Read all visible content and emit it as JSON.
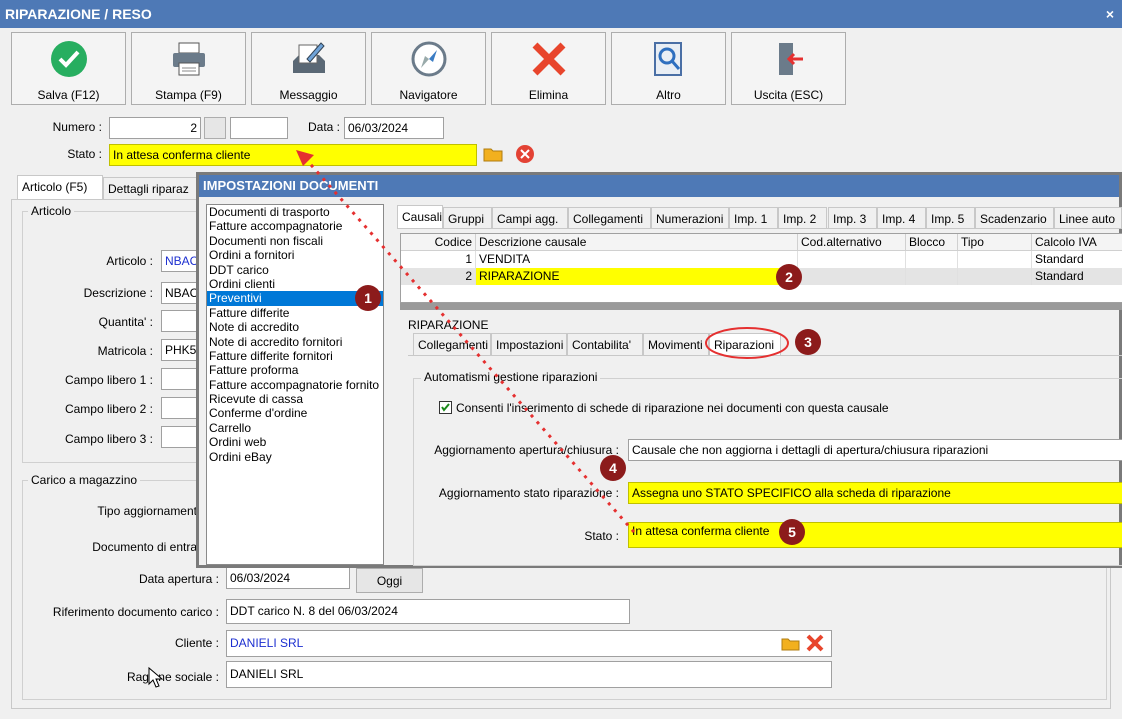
{
  "window": {
    "title": "RIPARAZIONE / RESO",
    "close": "×"
  },
  "toolbar": [
    {
      "label": "Salva (F12)",
      "icon": "check-icon"
    },
    {
      "label": "Stampa (F9)",
      "icon": "printer-icon"
    },
    {
      "label": "Messaggio",
      "icon": "message-icon"
    },
    {
      "label": "Navigatore",
      "icon": "compass-icon"
    },
    {
      "label": "Elimina",
      "icon": "delete-x-icon"
    },
    {
      "label": "Altro",
      "icon": "search-doc-icon"
    },
    {
      "label": "Uscita (ESC)",
      "icon": "exit-door-icon"
    }
  ],
  "header": {
    "numero_label": "Numero :",
    "numero_value": "2",
    "data_label": "Data :",
    "data_value": "06/03/2024",
    "stato_label": "Stato :",
    "stato_value": "In attesa conferma cliente"
  },
  "tabs": {
    "articolo": "Articolo (F5)",
    "dettagli": "Dettagli riparaz"
  },
  "articolo_group": {
    "title": "Articolo",
    "articolo_label": "Articolo :",
    "articolo_value": "NBAC",
    "descrizione_label": "Descrizione :",
    "descrizione_value": "NBAC",
    "quantita_label": "Quantita' :",
    "matricola_label": "Matricola :",
    "matricola_value": "PHK5",
    "campo1_label": "Campo libero 1 :",
    "campo2_label": "Campo libero 2 :",
    "campo3_label": "Campo libero 3 :"
  },
  "carico_group": {
    "title": "Carico a magazzino",
    "tipo_label": "Tipo aggiornament",
    "documento_label": "Documento di entra",
    "data_apertura_label": "Data apertura :",
    "data_apertura_value": "06/03/2024",
    "oggi_button": "Oggi",
    "riferimento_label": "Riferimento documento carico :",
    "riferimento_value": "DDT carico N. 8 del 06/03/2024",
    "cliente_label": "Cliente :",
    "cliente_value": "DANIELI SRL",
    "ragione_label": "Ragione sociale :",
    "ragione_value": "DANIELI SRL"
  },
  "dialog": {
    "title": "IMPOSTAZIONI DOCUMENTI",
    "doc_types": [
      "Documenti di trasporto",
      "Fatture accompagnatorie",
      "Documenti non fiscali",
      "Ordini a fornitori",
      "DDT carico",
      "Ordini clienti",
      "Preventivi",
      "Fatture differite",
      "Note di accredito",
      "Note di accredito fornitori",
      "Fatture differite fornitori",
      "Fatture proforma",
      "Fatture accompagnatorie fornito",
      "Ricevute di cassa",
      "Conferme d'ordine",
      "Carrello",
      "Ordini web",
      "Ordini eBay"
    ],
    "selected_index": 6,
    "top_tabs": [
      "Causali",
      "Gruppi",
      "Campi agg.",
      "Collegamenti",
      "Numerazioni",
      "Imp. 1",
      "Imp. 2",
      "Imp. 3",
      "Imp. 4",
      "Imp. 5",
      "Scadenzario",
      "Linee auto"
    ],
    "grid": {
      "headers": [
        "Codice",
        "Descrizione causale",
        "Cod.alternativo",
        "Blocco",
        "Tipo",
        "Calcolo IVA"
      ],
      "rows": [
        {
          "codice": "1",
          "descrizione": "VENDITA",
          "iva": "Standard"
        },
        {
          "codice": "2",
          "descrizione": "RIPARAZIONE",
          "iva": "Standard"
        }
      ]
    },
    "section_title": "RIPARAZIONE",
    "sub_tabs": [
      "Collegamenti",
      "Impostazioni",
      "Contabilita'",
      "Movimenti",
      "Riparazioni"
    ],
    "automatismi_title": "Automatismi gestione riparazioni",
    "consenti_label": "Consenti l'inserimento di schede di riparazione nei documenti con questa causale",
    "agg_apertura_label": "Aggiornamento apertura/chiusura :",
    "agg_apertura_value": "Causale che non aggiorna i dettagli di apertura/chiusura riparazioni",
    "agg_stato_label": "Aggiornamento stato riparazione :",
    "agg_stato_value": "Assegna uno STATO SPECIFICO alla scheda di riparazione",
    "stato_label": "Stato :",
    "stato_value": "In attesa conferma cliente"
  },
  "badges": [
    "1",
    "2",
    "3",
    "4",
    "5"
  ],
  "colors": {
    "title_bar": "#4e79b6",
    "highlight": "#ffff00",
    "badge": "#8c1b1b",
    "annotation": "#e53030"
  }
}
